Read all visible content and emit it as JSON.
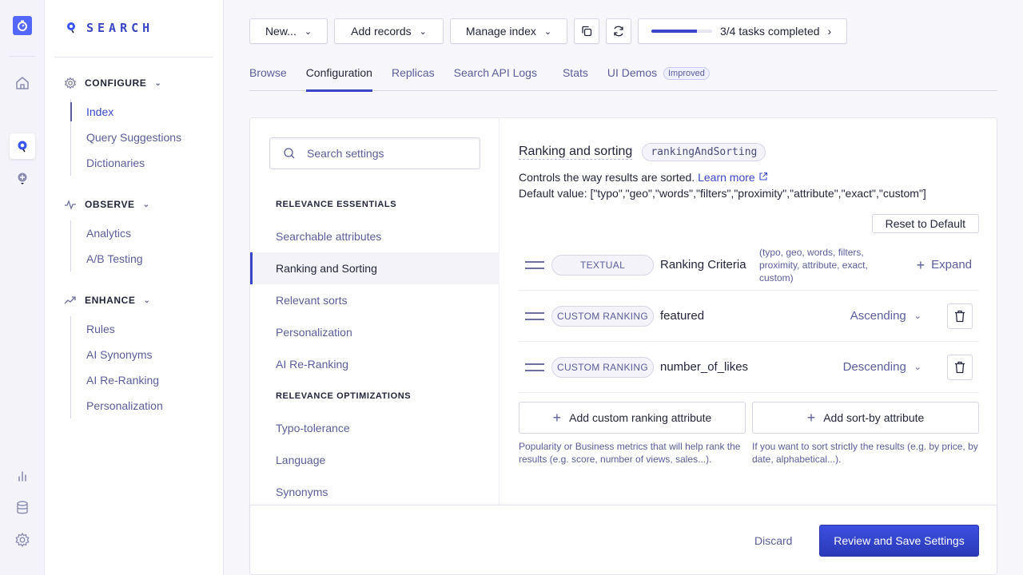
{
  "rail": {
    "icons": [
      "app-logo-icon",
      "home-icon",
      "search-product-icon",
      "discovery-product-icon",
      "analytics-icon",
      "data-sources-icon",
      "settings-icon"
    ]
  },
  "nav": {
    "brand": "SEARCH",
    "sections": [
      {
        "title": "CONFIGURE",
        "icon": "gear-icon",
        "items": [
          "Index",
          "Query Suggestions",
          "Dictionaries"
        ],
        "current": "Index"
      },
      {
        "title": "OBSERVE",
        "icon": "pulse-icon",
        "items": [
          "Analytics",
          "A/B Testing"
        ]
      },
      {
        "title": "ENHANCE",
        "icon": "trend-icon",
        "items": [
          "Rules",
          "AI Synonyms",
          "AI Re-Ranking",
          "Personalization"
        ]
      }
    ]
  },
  "toolbar": {
    "new_label": "New...",
    "add_records_label": "Add records",
    "manage_index_label": "Manage index",
    "tasks_label": "3/4 tasks completed",
    "tasks_progress": 0.75
  },
  "tabs": [
    {
      "label": "Browse"
    },
    {
      "label": "Configuration",
      "active": true
    },
    {
      "label": "Replicas"
    },
    {
      "label": "Search API Logs"
    },
    {
      "label": "Stats"
    },
    {
      "label": "UI Demos",
      "badge": "Improved"
    }
  ],
  "settings_nav": {
    "search_placeholder": "Search settings",
    "groups": [
      {
        "title": "RELEVANCE ESSENTIALS",
        "items": [
          "Searchable attributes",
          "Ranking and Sorting",
          "Relevant sorts",
          "Personalization",
          "AI Re-Ranking"
        ]
      },
      {
        "title": "RELEVANCE OPTIMIZATIONS",
        "items": [
          "Typo-tolerance",
          "Language",
          "Synonyms"
        ]
      }
    ],
    "selected": "Ranking and Sorting"
  },
  "setting": {
    "title": "Ranking and sorting",
    "code": "rankingAndSorting",
    "description": "Controls the way results are sorted.",
    "learn_more": "Learn more",
    "default_value": "Default value: [\"typo\",\"geo\",\"words\",\"filters\",\"proximity\",\"attribute\",\"exact\",\"custom\"]",
    "reset_label": "Reset to Default",
    "rows": [
      {
        "kind": "TEXTUAL",
        "name": "Ranking Criteria",
        "note": "(typo, geo, words, filters, proximity, attribute, exact, custom)",
        "action": "Expand"
      },
      {
        "kind": "CUSTOM RANKING",
        "name": "featured",
        "order": "Ascending"
      },
      {
        "kind": "CUSTOM RANKING",
        "name": "number_of_likes",
        "order": "Descending"
      }
    ],
    "add_custom_label": "Add custom ranking attribute",
    "add_custom_help": "Popularity or Business metrics that will help rank the results (e.g. score, number of views, sales...).",
    "add_sort_label": "Add sort-by attribute",
    "add_sort_help": "If you want to sort strictly the results (e.g. by price, by date, alphabetical...)."
  },
  "footer": {
    "discard_label": "Discard",
    "save_label": "Review and Save Settings"
  },
  "colors": {
    "accent": "#3a46c6",
    "brand": "#5468ff",
    "text": "#23263b",
    "muted": "#5a5e9a"
  }
}
